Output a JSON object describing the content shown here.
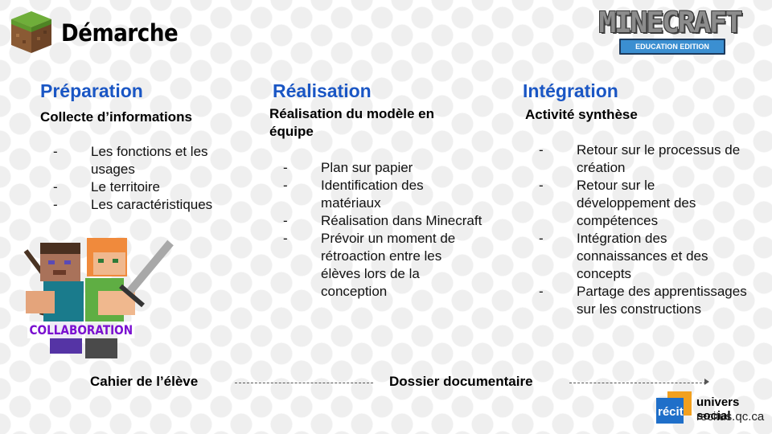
{
  "header": {
    "title": "Démarche",
    "logo_main": "MINECRAFT",
    "logo_sub": "EDUCATION EDITION"
  },
  "columns": [
    {
      "title": "Préparation",
      "subtitle": "Collecte d’informations",
      "items": [
        "Les fonctions et les usages",
        "Le territoire",
        "Les caractéristiques"
      ]
    },
    {
      "title": "Réalisation",
      "subtitle": "Réalisation du modèle en équipe",
      "items": [
        "Plan sur papier",
        "Identification des matériaux",
        "Réalisation dans Minecraft",
        "Prévoir un moment de rétroaction entre les élèves lors de la conception"
      ]
    },
    {
      "title": "Intégration",
      "subtitle": "Activité synthèse",
      "items": [
        "Retour sur le processus de création",
        "Retour sur le développement des compétences",
        "Intégration des connaissances et des concepts",
        "Partage des apprentissages sur les constructions"
      ]
    }
  ],
  "bullet": "-",
  "collaboration_label": "COLLABORATION",
  "flow": {
    "step1": "Cahier de l’élève",
    "step2": "Dossier documentaire"
  },
  "footer": {
    "logo_text": "récit",
    "line1": "univers social",
    "line2": "recitus.qc.ca"
  },
  "colors": {
    "heading_blue": "#1a56c4",
    "collab_purple": "#7a0fd0",
    "recit_blue": "#1f6fc9",
    "recit_orange": "#f2a01f"
  }
}
